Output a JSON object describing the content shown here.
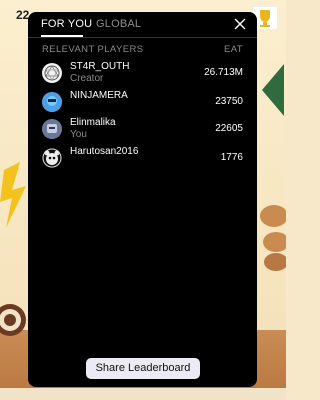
{
  "background": {
    "score": "22"
  },
  "modal": {
    "tabs": [
      {
        "label": "FOR YOU",
        "active": true
      },
      {
        "label": "GLOBAL",
        "active": false
      }
    ],
    "close_icon": "close-icon",
    "section_label": "RELEVANT PLAYERS",
    "metric_label": "EAT",
    "players": [
      {
        "name": "ST4R_OUTH",
        "sub": "Creator",
        "score": "26.713M",
        "avatar": "geometric-avatar"
      },
      {
        "name": "NINJAMERA",
        "sub": "",
        "score": "23750",
        "avatar": "blue-character-avatar"
      },
      {
        "name": "Elinmalika",
        "sub": "You",
        "score": "22605",
        "avatar": "robot-avatar"
      },
      {
        "name": "Harutosan2016",
        "sub": "",
        "score": "1776",
        "avatar": "panda-avatar"
      }
    ],
    "share_button": "Share Leaderboard"
  },
  "colors": {
    "modal_bg": "#000000",
    "muted_text": "#8a8a8a",
    "button_bg": "#ecebf4"
  }
}
